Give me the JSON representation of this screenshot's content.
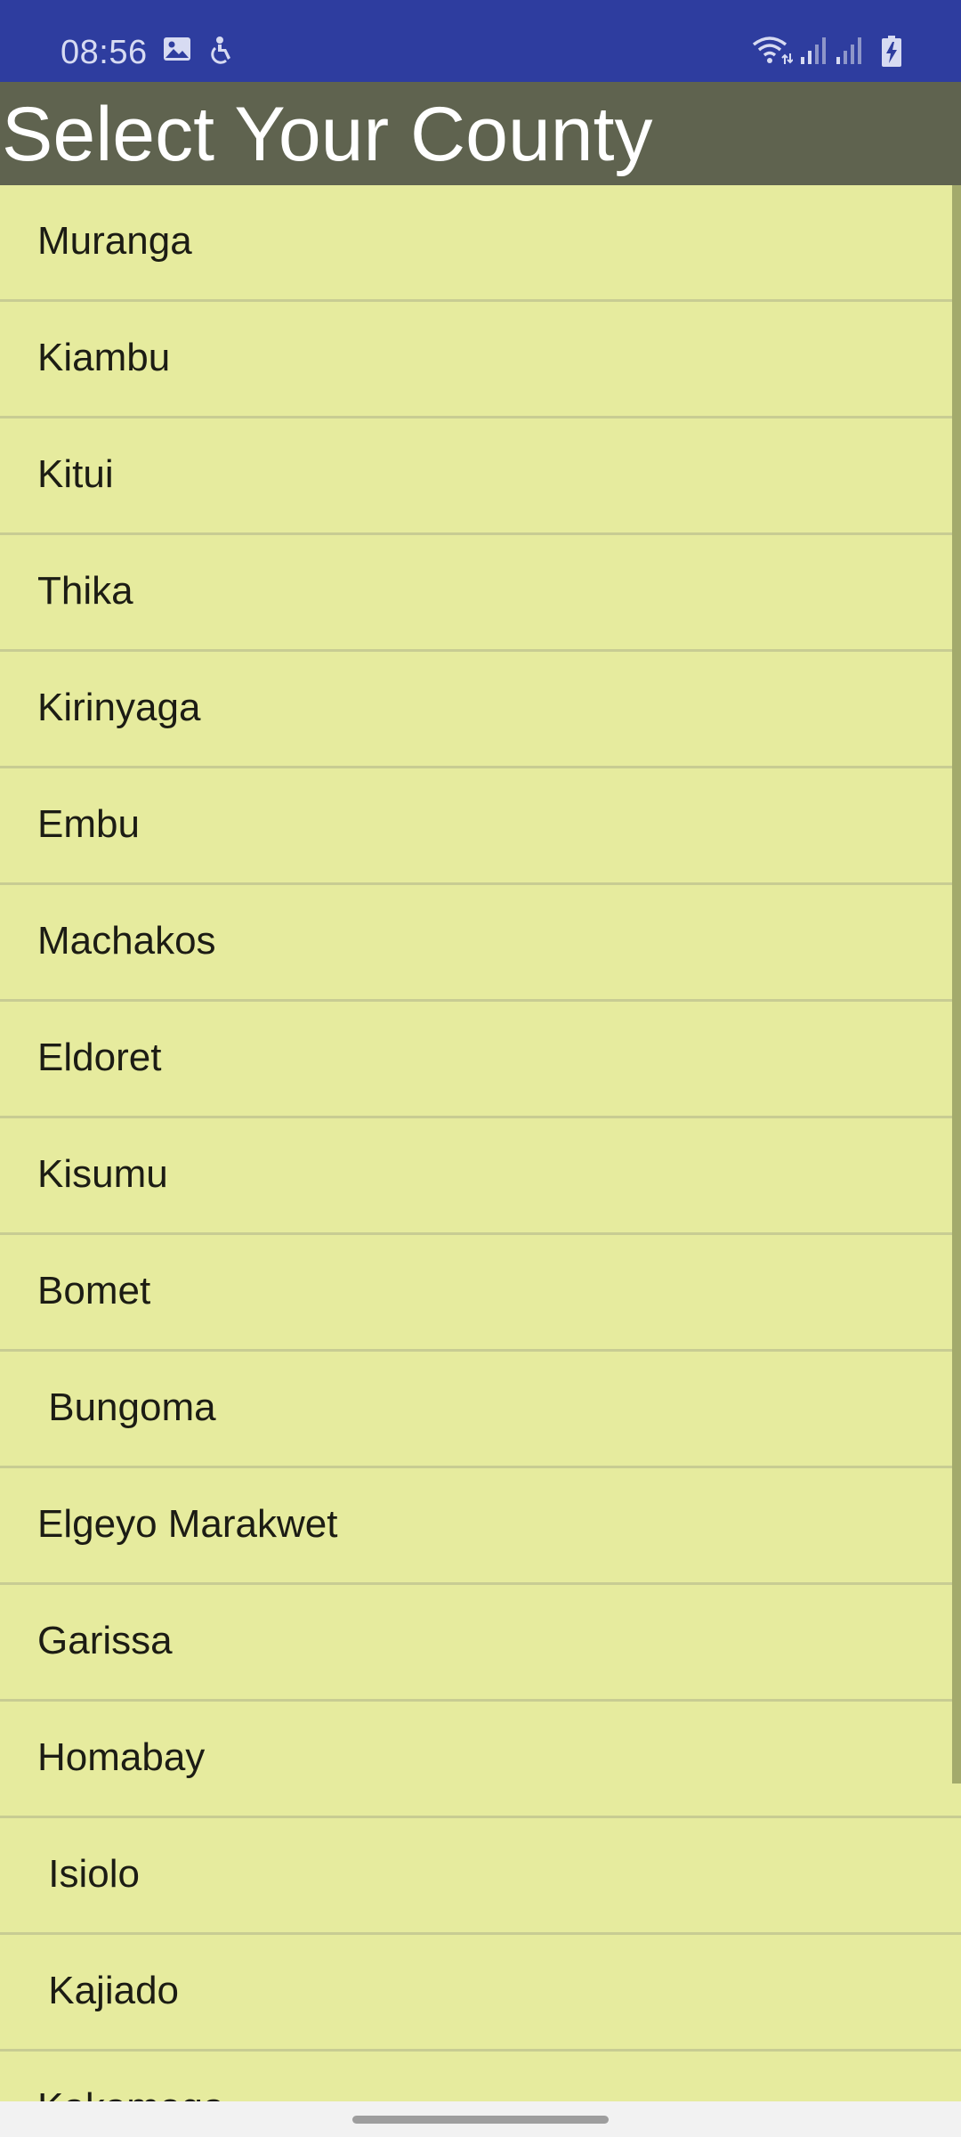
{
  "status_bar": {
    "time": "08:56",
    "icons": [
      "gallery-icon",
      "accessibility-icon",
      "wifi-icon",
      "signal-icon",
      "signal-icon",
      "battery-charging-icon"
    ]
  },
  "header": {
    "title": "Select Your County"
  },
  "counties": [
    "Muranga",
    "Kiambu",
    "Kitui",
    "Thika",
    "Kirinyaga",
    "Embu",
    "Machakos",
    "Eldoret",
    "Kisumu",
    "Bomet",
    " Bungoma",
    "Elgeyo Marakwet",
    "Garissa",
    "Homabay",
    " Isiolo",
    " Kajiado",
    "Kakamega"
  ],
  "colors": {
    "status_bar": "#2e3d9f",
    "title_bar": "#5f634f",
    "list_background": "#e6eb9e",
    "divider": "#c8cc93"
  }
}
